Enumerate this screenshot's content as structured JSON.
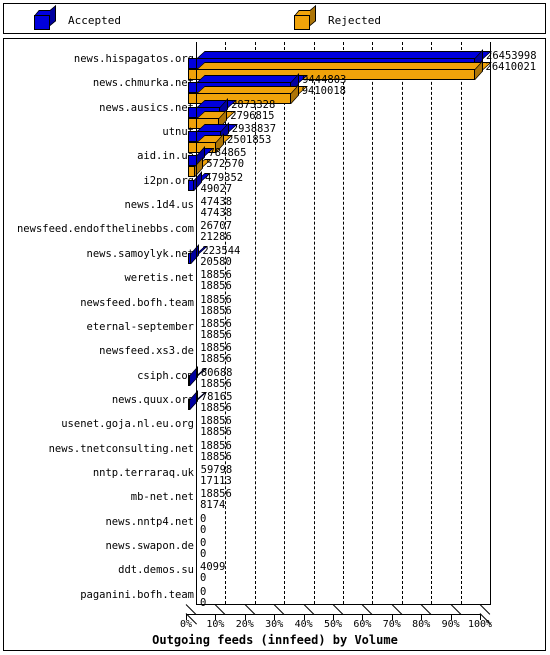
{
  "legend": {
    "items": [
      {
        "label": "Accepted",
        "color": "#0000dd",
        "icon": "cube-icon"
      },
      {
        "label": "Rejected",
        "color": "#f0a30a",
        "icon": "cube-icon"
      }
    ]
  },
  "chart_data": {
    "type": "bar",
    "orientation": "horizontal",
    "title": "Outgoing feeds (innfeed) by Volume",
    "xlabel": "",
    "ylabel": "",
    "grid": true,
    "legend_position": "top",
    "xlim": [
      0,
      100
    ],
    "x_unit": "%",
    "xtick_labels": [
      "0%",
      "10%",
      "20%",
      "30%",
      "40%",
      "50%",
      "60%",
      "70%",
      "80%",
      "90%",
      "100%"
    ],
    "xtick_values": [
      0,
      10,
      20,
      30,
      40,
      50,
      60,
      70,
      80,
      90,
      100
    ],
    "categories": [
      "news.hispagatos.org",
      "news.chmurka.net",
      "news.ausics.net",
      "utnut",
      "aid.in.ua",
      "i2pn.org",
      "news.1d4.us",
      "newsfeed.endofthelinebbs.com",
      "news.samoylyk.net",
      "weretis.net",
      "newsfeed.bofh.team",
      "eternal-september",
      "newsfeed.xs3.de",
      "csiph.com",
      "news.quux.org",
      "usenet.goja.nl.eu.org",
      "news.tnetconsulting.net",
      "nntp.terraraq.uk",
      "mb-net.net",
      "news.nntp4.net",
      "news.swapon.de",
      "ddt.demos.su",
      "paganini.bofh.team"
    ],
    "series": [
      {
        "name": "Accepted",
        "color": "#0000dd",
        "values": [
          26453998,
          9444803,
          2873328,
          2938837,
          784865,
          479352,
          47438,
          26707,
          223544,
          18856,
          18856,
          18856,
          18856,
          80688,
          78165,
          18856,
          18856,
          59798,
          18856,
          0,
          0,
          4099,
          0
        ]
      },
      {
        "name": "Rejected",
        "color": "#f0a30a",
        "values": [
          26410021,
          9410018,
          2796815,
          2501853,
          572570,
          49027,
          47438,
          21286,
          20580,
          18856,
          18856,
          18856,
          18856,
          18856,
          18856,
          18856,
          18856,
          17113,
          8174,
          0,
          0,
          0,
          0
        ]
      }
    ],
    "value_labels": [
      {
        "accepted": "26453998",
        "rejected": "26410021"
      },
      {
        "accepted": "9444803",
        "rejected": "9410018"
      },
      {
        "accepted": "2873328",
        "rejected": "2796815"
      },
      {
        "accepted": "2938837",
        "rejected": "2501853"
      },
      {
        "accepted": "784865",
        "rejected": "572570"
      },
      {
        "accepted": "479352",
        "rejected": "49027"
      },
      {
        "accepted": "47438",
        "rejected": "47438"
      },
      {
        "accepted": "26707",
        "rejected": "21286"
      },
      {
        "accepted": "223544",
        "rejected": "20580"
      },
      {
        "accepted": "18856",
        "rejected": "18856"
      },
      {
        "accepted": "18856",
        "rejected": "18856"
      },
      {
        "accepted": "18856",
        "rejected": "18856"
      },
      {
        "accepted": "18856",
        "rejected": "18856"
      },
      {
        "accepted": "80688",
        "rejected": "18856"
      },
      {
        "accepted": "78165",
        "rejected": "18856"
      },
      {
        "accepted": "18856",
        "rejected": "18856"
      },
      {
        "accepted": "18856",
        "rejected": "18856"
      },
      {
        "accepted": "59798",
        "rejected": "17113"
      },
      {
        "accepted": "18856",
        "rejected": "8174"
      },
      {
        "accepted": "0",
        "rejected": "0"
      },
      {
        "accepted": "0",
        "rejected": "0"
      },
      {
        "accepted": "4099",
        "rejected": "0"
      },
      {
        "accepted": "0",
        "rejected": "0"
      }
    ]
  }
}
